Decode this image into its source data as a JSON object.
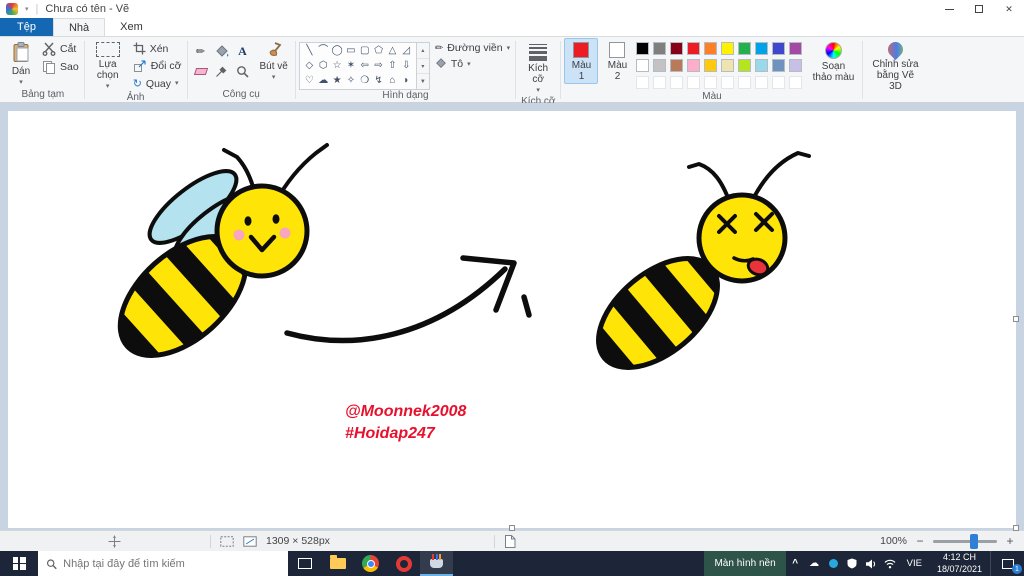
{
  "titlebar": {
    "title": "Chưa có tên - Vẽ"
  },
  "tabs": {
    "file": "Tệp",
    "home": "Nhà",
    "view": "Xem"
  },
  "icons": {
    "caret": "▾",
    "scroll_up": "▴",
    "scroll_down": "▾",
    "more": "▼",
    "close": "✕",
    "pencil": "✏",
    "rotate": "↻",
    "text_tool": "A",
    "chevron_up": "^",
    "cloud": "☁",
    "zoom_out": "−",
    "zoom_in": "+"
  },
  "ribbon": {
    "clipboard": {
      "section": "Bảng tạm",
      "paste": "Dán",
      "cut": "Cắt",
      "copy": "Sao"
    },
    "image": {
      "section": "Ảnh",
      "select": "Lựa chọn",
      "crop": "Xén",
      "resize": "Đổi cỡ",
      "rotate": "Quay"
    },
    "tools": {
      "section": "Công cụ",
      "brushes": "Bút vẽ"
    },
    "shapes": {
      "section": "Hình dạng",
      "outline": "Đường viền",
      "fill": "Tô",
      "glyph_rows": [
        [
          "╲",
          "⌒",
          "◯",
          "▭",
          "▢",
          "⬠",
          "△",
          "◿"
        ],
        [
          "◇",
          "⬡",
          "☆",
          "✶",
          "⇦",
          "⇨",
          "⇧",
          "⇩"
        ],
        [
          "♡",
          "☁",
          "★",
          "✧",
          "❍",
          "↯",
          "⌂",
          "◗"
        ]
      ]
    },
    "size": {
      "section": "Kích cỡ",
      "label": "Kích cỡ"
    },
    "colors": {
      "section": "Màu",
      "color1_label": "Màu 1",
      "color2_label": "Màu 2",
      "edit_label": "Soạn thảo màu",
      "color1": "#ed1c24",
      "color2": "#ffffff",
      "palette": [
        [
          "#000000",
          "#7f7f7f",
          "#880015",
          "#ed1c24",
          "#ff7f27",
          "#fff200",
          "#22b14c",
          "#00a2e8",
          "#3f48cc",
          "#a349a4"
        ],
        [
          "#ffffff",
          "#c3c3c3",
          "#b97a57",
          "#ffaec9",
          "#ffc90e",
          "#efe4b0",
          "#b5e61d",
          "#99d9ea",
          "#7092be",
          "#c8bfe7"
        ]
      ]
    },
    "paint3d": {
      "label": "Chỉnh sửa bằng Vẽ 3D"
    }
  },
  "canvas": {
    "credit1": "@Moonnek2008",
    "credit2": "#Hoidap247",
    "credit_color": "#e8112d"
  },
  "statusbar": {
    "dimensions": "1309 × 528px",
    "zoom": "100%"
  },
  "taskbar": {
    "search_placeholder": "Nhập tại đây để tìm kiếm",
    "desktop": "Màn hình nền",
    "lang": "VIE",
    "time": "4:12 CH",
    "date": "18/07/2021",
    "badge": "1"
  }
}
